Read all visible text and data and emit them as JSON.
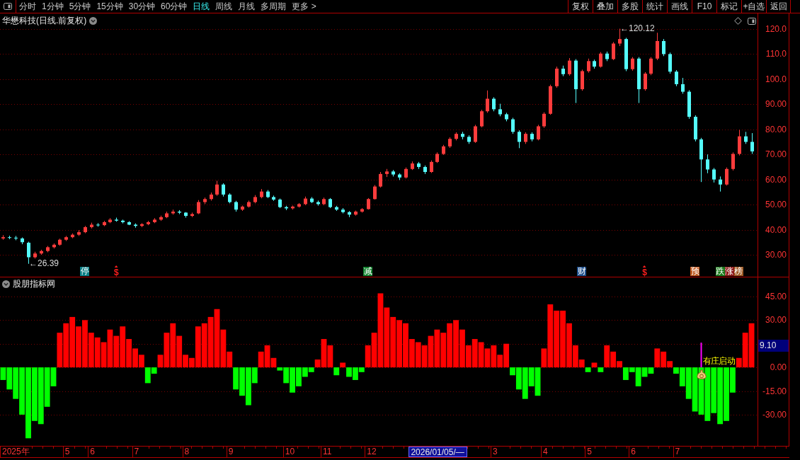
{
  "toolbar": {
    "periods": [
      {
        "label": "分时",
        "selected": false
      },
      {
        "label": "1分钟",
        "selected": false
      },
      {
        "label": "5分钟",
        "selected": false
      },
      {
        "label": "15分钟",
        "selected": false
      },
      {
        "label": "30分钟",
        "selected": false
      },
      {
        "label": "60分钟",
        "selected": false
      },
      {
        "label": "日线",
        "selected": true
      },
      {
        "label": "周线",
        "selected": false
      },
      {
        "label": "月线",
        "selected": false
      },
      {
        "label": "多周期",
        "selected": false
      },
      {
        "label": "更多 >",
        "selected": false
      }
    ],
    "buttons": [
      "复权",
      "叠加",
      "多股",
      "统计",
      "画线",
      "F10",
      "标记",
      "+自选",
      "返回"
    ]
  },
  "price_pane": {
    "title": "华懋科技(日线.前复权)",
    "chart_data": [
      {
        "type": "candlestick",
        "grid": true,
        "ylim": [
          21.25,
          126.2
        ],
        "yticks": [
          {
            "value": 120,
            "label": "120.0"
          },
          {
            "value": 110,
            "label": "110.0"
          },
          {
            "value": 100,
            "label": "100.0"
          },
          {
            "value": 90,
            "label": "90.00"
          },
          {
            "value": 80,
            "label": "80.00"
          },
          {
            "value": 70,
            "label": "70.00"
          },
          {
            "value": 60,
            "label": "60.00"
          },
          {
            "value": 50,
            "label": "50.00"
          },
          {
            "value": 40,
            "label": "40.00"
          },
          {
            "value": 30,
            "label": "30.00"
          }
        ],
        "ohlc": [
          [
            36.5,
            37.8,
            36.0,
            37.0
          ],
          [
            37.0,
            37.6,
            36.2,
            36.8
          ],
          [
            36.8,
            37.5,
            35.8,
            36.5
          ],
          [
            36.5,
            36.9,
            34.2,
            35.0
          ],
          [
            34.8,
            35.2,
            26.39,
            29.0
          ],
          [
            29.0,
            31.2,
            28.5,
            30.5
          ],
          [
            30.5,
            32.0,
            30.0,
            31.5
          ],
          [
            31.5,
            33.5,
            31.0,
            33.0
          ],
          [
            33.0,
            34.5,
            32.5,
            34.0
          ],
          [
            34.0,
            36.4,
            33.6,
            36.0
          ],
          [
            36.0,
            37.5,
            35.5,
            37.0
          ],
          [
            37.0,
            38.5,
            36.6,
            38.0
          ],
          [
            38.0,
            39.8,
            37.5,
            39.0
          ],
          [
            39.0,
            41.5,
            38.6,
            41.0
          ],
          [
            41.0,
            42.8,
            40.5,
            42.0
          ],
          [
            42.0,
            42.6,
            41.2,
            41.8
          ],
          [
            41.8,
            43.5,
            41.4,
            43.0
          ],
          [
            43.0,
            44.6,
            42.6,
            44.0
          ],
          [
            44.0,
            44.8,
            43.2,
            43.6
          ],
          [
            43.6,
            44.0,
            42.5,
            43.0
          ],
          [
            43.0,
            43.4,
            41.8,
            42.0
          ],
          [
            42.0,
            42.5,
            40.8,
            41.5
          ],
          [
            41.5,
            42.6,
            41.0,
            42.2
          ],
          [
            42.2,
            43.5,
            41.8,
            43.0
          ],
          [
            43.0,
            44.6,
            42.6,
            44.0
          ],
          [
            44.0,
            45.6,
            43.5,
            45.0
          ],
          [
            45.0,
            47.2,
            44.6,
            46.5
          ],
          [
            46.5,
            48.0,
            46.0,
            47.2
          ],
          [
            47.2,
            47.8,
            46.2,
            46.8
          ],
          [
            46.8,
            47.0,
            44.8,
            45.5
          ],
          [
            45.5,
            46.8,
            45.0,
            46.2
          ],
          [
            46.5,
            51.8,
            46.2,
            51.0
          ],
          [
            51.0,
            52.8,
            50.2,
            52.2
          ],
          [
            52.2,
            54.8,
            51.6,
            54.0
          ],
          [
            54.0,
            59.5,
            53.5,
            58.0
          ],
          [
            58.0,
            58.5,
            53.2,
            54.0
          ],
          [
            54.0,
            54.5,
            50.5,
            51.0
          ],
          [
            51.0,
            51.5,
            47.2,
            48.0
          ],
          [
            48.0,
            49.6,
            47.5,
            49.2
          ],
          [
            49.2,
            51.6,
            48.8,
            51.0
          ],
          [
            51.0,
            53.8,
            50.5,
            53.0
          ],
          [
            53.0,
            56.2,
            52.5,
            55.2
          ],
          [
            55.2,
            55.8,
            52.6,
            53.0
          ],
          [
            53.0,
            53.6,
            51.5,
            52.0
          ],
          [
            52.0,
            52.4,
            48.6,
            49.0
          ],
          [
            49.0,
            49.5,
            47.8,
            48.5
          ],
          [
            48.5,
            49.6,
            48.0,
            49.2
          ],
          [
            49.2,
            50.6,
            48.8,
            50.2
          ],
          [
            50.2,
            53.2,
            49.8,
            52.4
          ],
          [
            52.4,
            53.0,
            50.6,
            51.0
          ],
          [
            51.0,
            51.6,
            49.6,
            50.2
          ],
          [
            50.2,
            52.8,
            49.8,
            52.2
          ],
          [
            52.2,
            52.6,
            48.6,
            49.0
          ],
          [
            49.0,
            49.5,
            47.5,
            48.0
          ],
          [
            48.0,
            48.6,
            46.5,
            47.0
          ],
          [
            47.0,
            47.4,
            45.0,
            46.0
          ],
          [
            46.0,
            47.6,
            45.6,
            47.2
          ],
          [
            47.2,
            48.6,
            46.8,
            48.2
          ],
          [
            48.2,
            52.6,
            48.0,
            52.2
          ],
          [
            52.2,
            57.8,
            52.0,
            57.2
          ],
          [
            57.2,
            63.0,
            56.8,
            62.2
          ],
          [
            62.2,
            64.2,
            61.0,
            63.2
          ],
          [
            63.2,
            63.8,
            61.2,
            62.0
          ],
          [
            62.0,
            62.5,
            59.8,
            60.8
          ],
          [
            60.8,
            64.8,
            60.4,
            64.2
          ],
          [
            64.2,
            67.2,
            63.8,
            66.4
          ],
          [
            66.4,
            67.0,
            64.2,
            65.0
          ],
          [
            65.0,
            65.6,
            62.2,
            63.0
          ],
          [
            63.0,
            67.6,
            62.6,
            67.0
          ],
          [
            67.0,
            70.8,
            66.6,
            70.2
          ],
          [
            70.2,
            73.8,
            69.8,
            73.2
          ],
          [
            73.2,
            76.8,
            72.6,
            76.2
          ],
          [
            76.2,
            78.8,
            75.6,
            78.2
          ],
          [
            78.2,
            79.0,
            76.0,
            77.0
          ],
          [
            77.0,
            77.6,
            74.2,
            75.0
          ],
          [
            75.0,
            81.8,
            74.6,
            81.2
          ],
          [
            81.2,
            87.8,
            80.8,
            87.2
          ],
          [
            87.2,
            95.5,
            86.6,
            92.2
          ],
          [
            92.2,
            92.8,
            87.2,
            88.0
          ],
          [
            88.0,
            90.2,
            85.2,
            86.0
          ],
          [
            86.0,
            86.6,
            83.2,
            84.0
          ],
          [
            84.0,
            84.6,
            78.2,
            79.0
          ],
          [
            79.0,
            79.6,
            72.5,
            75.0
          ],
          [
            75.0,
            78.8,
            74.2,
            78.2
          ],
          [
            78.2,
            78.8,
            75.2,
            76.0
          ],
          [
            76.0,
            81.8,
            75.6,
            81.2
          ],
          [
            81.2,
            86.8,
            80.6,
            86.2
          ],
          [
            86.2,
            97.8,
            85.8,
            97.2
          ],
          [
            97.2,
            105.0,
            96.6,
            104.2
          ],
          [
            104.2,
            105.4,
            101.2,
            102.0
          ],
          [
            102.0,
            108.4,
            101.4,
            107.4
          ],
          [
            107.4,
            108.0,
            90.5,
            96.0
          ],
          [
            96.0,
            103.8,
            95.4,
            103.2
          ],
          [
            103.2,
            108.2,
            102.6,
            107.2
          ],
          [
            107.2,
            107.8,
            104.2,
            105.0
          ],
          [
            105.0,
            110.8,
            104.6,
            110.2
          ],
          [
            110.2,
            111.0,
            107.2,
            108.0
          ],
          [
            108.0,
            114.8,
            107.6,
            114.2
          ],
          [
            114.2,
            120.12,
            113.2,
            116.0
          ],
          [
            116.0,
            116.5,
            103.2,
            104.0
          ],
          [
            104.0,
            108.8,
            103.4,
            108.2
          ],
          [
            108.2,
            108.8,
            90.5,
            96.0
          ],
          [
            96.0,
            102.8,
            95.4,
            102.2
          ],
          [
            102.2,
            108.8,
            101.6,
            108.2
          ],
          [
            108.2,
            118.5,
            107.6,
            115.2
          ],
          [
            115.2,
            116.0,
            109.2,
            110.0
          ],
          [
            110.0,
            110.6,
            102.2,
            103.0
          ],
          [
            103.0,
            103.6,
            97.2,
            98.0
          ],
          [
            98.0,
            100.5,
            94.2,
            95.0
          ],
          [
            95.0,
            95.6,
            84.2,
            85.0
          ],
          [
            85.0,
            85.6,
            75.2,
            76.0
          ],
          [
            76.0,
            76.6,
            59.0,
            68.0
          ],
          [
            68.0,
            70.0,
            62.5,
            64.0
          ],
          [
            64.0,
            64.6,
            58.8,
            60.0
          ],
          [
            60.0,
            61.2,
            55.2,
            58.0
          ],
          [
            58.0,
            64.8,
            57.6,
            64.2
          ],
          [
            64.2,
            70.8,
            63.6,
            70.2
          ],
          [
            70.2,
            79.8,
            69.6,
            77.2
          ],
          [
            77.2,
            79.0,
            74.2,
            75.0
          ],
          [
            75.0,
            78.5,
            70.2,
            71.2
          ]
        ],
        "annotations": [
          "←120.12",
          "←26.39"
        ]
      }
    ],
    "markers": [
      {
        "kind": "tag",
        "items": [
          {
            "text": "停",
            "color": "#0b7f86"
          }
        ]
      },
      {
        "kind": "sign",
        "items": [
          {
            "text": "$",
            "color": "#ff1e1e"
          }
        ]
      },
      {
        "kind": "tag",
        "items": [
          {
            "text": "减",
            "color": "#12822e"
          }
        ]
      },
      {
        "kind": "tag",
        "items": [
          {
            "text": "财",
            "color": "#1e4f8c"
          }
        ]
      },
      {
        "kind": "sign",
        "items": [
          {
            "text": "$",
            "color": "#ff1e1e"
          }
        ]
      },
      {
        "kind": "tag",
        "items": [
          {
            "text": "预",
            "color": "#c0561c"
          }
        ]
      },
      {
        "kind": "tag",
        "items": [
          {
            "text": "跌",
            "color": "#1b7a1b"
          },
          {
            "text": "涨",
            "color": "#8e1a1a"
          },
          {
            "text": "榜",
            "color": "#a05a24"
          }
        ]
      }
    ]
  },
  "indicator_pane": {
    "title": "股朋指标网",
    "chart_data": [
      {
        "type": "bar",
        "grid": true,
        "ylim": [
          -49.8,
          57.1
        ],
        "yticks": [
          {
            "value": 45,
            "label": "45.00"
          },
          {
            "value": 30,
            "label": "30.00"
          },
          {
            "value": 0,
            "label": "0.00"
          },
          {
            "value": -15,
            "label": "-15.00"
          },
          {
            "value": -30,
            "label": "-30.00"
          }
        ],
        "series": [
          {
            "color": "#ff0000",
            "values": [
              null,
              null,
              null,
              null,
              null,
              null,
              null,
              null,
              null,
              22,
              28,
              32,
              26,
              30,
              22,
              19,
              16,
              24,
              20,
              26,
              18,
              12,
              8,
              null,
              null,
              8,
              22,
              28,
              20,
              8,
              6,
              26,
              28,
              32,
              37,
              24,
              10,
              null,
              null,
              null,
              null,
              10,
              14,
              6,
              null,
              null,
              null,
              null,
              null,
              null,
              5,
              18,
              14,
              null,
              3,
              null,
              null,
              null,
              14,
              22,
              47,
              38,
              32,
              30,
              28,
              18,
              16,
              14,
              20,
              24,
              22,
              28,
              30,
              24,
              14,
              18,
              16,
              12,
              14,
              8,
              15,
              null,
              null,
              null,
              null,
              null,
              12,
              40,
              36,
              36,
              28,
              14,
              5,
              null,
              3,
              null,
              14,
              10,
              4,
              null,
              null,
              null,
              null,
              null,
              12,
              10,
              4,
              null,
              null,
              null,
              null,
              null,
              null,
              null,
              null,
              null,
              null,
              6,
              22,
              28
            ]
          },
          {
            "color": "#00ff00",
            "values": [
              -8,
              -14,
              -20,
              -30,
              -45,
              -34,
              -36,
              -25,
              -12,
              null,
              null,
              null,
              null,
              null,
              null,
              null,
              null,
              null,
              null,
              null,
              null,
              null,
              null,
              -10,
              -4,
              null,
              null,
              null,
              null,
              null,
              null,
              null,
              null,
              null,
              null,
              null,
              null,
              -14,
              -18,
              -24,
              -10,
              null,
              null,
              null,
              -2,
              -10,
              -16,
              -12,
              -6,
              -3,
              null,
              null,
              null,
              -5,
              null,
              -6,
              -8,
              -3,
              null,
              null,
              null,
              null,
              null,
              null,
              null,
              null,
              null,
              null,
              null,
              null,
              null,
              null,
              null,
              null,
              null,
              null,
              null,
              null,
              null,
              null,
              null,
              -5,
              -14,
              -20,
              -12,
              -18,
              null,
              null,
              null,
              null,
              null,
              null,
              null,
              -3,
              null,
              -3,
              null,
              null,
              null,
              -8,
              -3,
              -12,
              -6,
              -4,
              null,
              null,
              null,
              -4,
              -12,
              -20,
              -28,
              -30,
              -34,
              -29,
              -36,
              -34,
              -16,
              null,
              null,
              null
            ]
          }
        ]
      }
    ],
    "signal": {
      "text": "有庄启动"
    },
    "readout": "9.10"
  },
  "timeline": [
    {
      "label": "2025年",
      "selected": false
    },
    {
      "label": "5",
      "selected": false
    },
    {
      "label": "6",
      "selected": false
    },
    {
      "label": "7",
      "selected": false
    },
    {
      "label": "8",
      "selected": false
    },
    {
      "label": "9",
      "selected": false
    },
    {
      "label": "10",
      "selected": false
    },
    {
      "label": "11",
      "selected": false
    },
    {
      "label": "12",
      "selected": false
    },
    {
      "label": "2026/01/05/—",
      "selected": true
    },
    {
      "label": "3",
      "selected": false
    },
    {
      "label": "4",
      "selected": false
    },
    {
      "label": "5",
      "selected": false
    },
    {
      "label": "6",
      "selected": false
    },
    {
      "label": "7",
      "selected": false
    }
  ]
}
